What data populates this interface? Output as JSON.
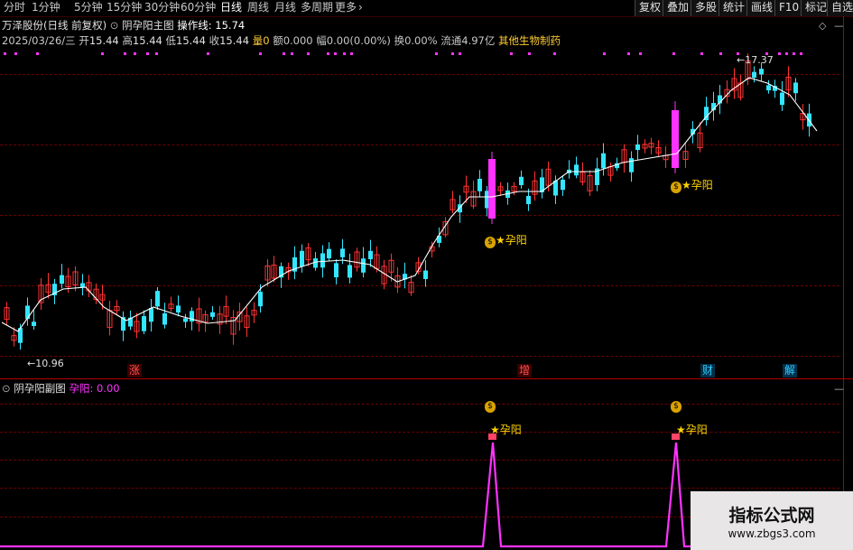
{
  "toolbar": {
    "periods": [
      "分时",
      "1分钟",
      "5分钟",
      "15分钟",
      "30分钟",
      "60分钟",
      "日线",
      "周线",
      "月线",
      "多周期",
      "更多"
    ],
    "active_period": "日线",
    "right_buttons": [
      "复权",
      "叠加",
      "多股",
      "统计",
      "画线",
      "F10",
      "标记",
      "自选"
    ]
  },
  "main_panel": {
    "stock": "万泽股份(日线 前复权)",
    "indicator": "阴孕阳主图",
    "op_label": "操作线:",
    "op_value": "15.74",
    "date": "2025/03/26/三",
    "open_label": "开",
    "open": "15.44",
    "high_label": "高",
    "high": "15.44",
    "low_label": "低",
    "low": "15.44",
    "close_label": "收",
    "close": "15.44",
    "vol_label": "量",
    "vol": "0",
    "amount_label": "额",
    "amount": "0.000",
    "range_label": "幅",
    "range": "0.00(0.00%)",
    "turnover_label": "换",
    "turnover": "0.00%",
    "float_label": "流通",
    "float": "4.97亿",
    "sector": "其他生物制药",
    "max_label": "17.37",
    "min_label": "10.96",
    "signal_label": "孕阳",
    "event_tags": [
      "涨",
      "增",
      "财",
      "解"
    ]
  },
  "sub_panel": {
    "indicator": "阴孕阳副图",
    "value_label": "孕阳:",
    "value": "0.00",
    "signal_label": "孕阳"
  },
  "watermark": {
    "title": "指标公式网",
    "url": "www.zbgs3.com"
  },
  "colors": {
    "up": "#ff3333",
    "down": "#33e6ff",
    "signal": "#ff33ff",
    "ma": "#ffffff",
    "grid": "#6a0000",
    "sector": "#ffcc33"
  }
}
